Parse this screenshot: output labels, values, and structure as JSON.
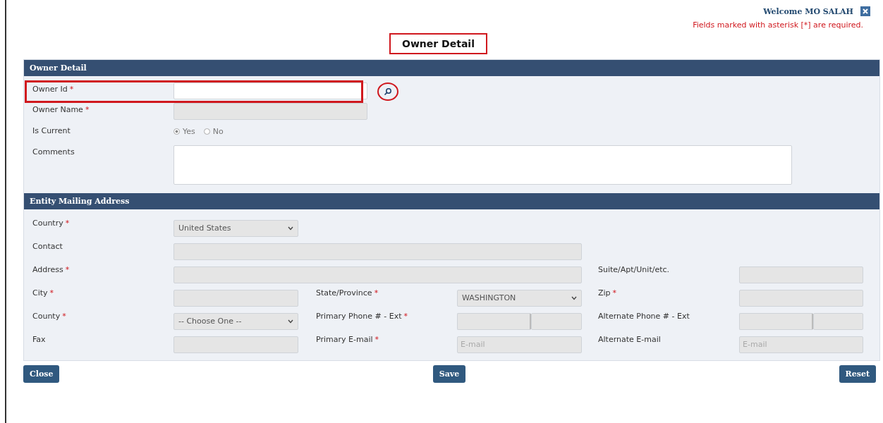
{
  "header": {
    "welcome": "Welcome MO SALAH",
    "required_note": "Fields marked with asterisk [*] are required."
  },
  "title": "Owner Detail",
  "owner_section": {
    "title": "Owner Detail",
    "fields": [
      {
        "label": "Owner Id",
        "required_mark": "*",
        "kind": "lookup",
        "disabled": false,
        "highlighted": true
      },
      {
        "label": "Owner Name",
        "required_mark": "*",
        "kind": "text",
        "disabled": true,
        "highlighted": false
      },
      {
        "label": "Is Current",
        "kind": "radio",
        "options": [
          {
            "label": "Yes",
            "selected": true
          },
          {
            "label": "No",
            "selected": false
          }
        ]
      },
      {
        "label": "Comments",
        "kind": "textarea",
        "disabled": false,
        "highlighted": false
      }
    ]
  },
  "address_section": {
    "title": "Entity Mailing Address",
    "rows": [
      [
        {
          "label": "Country",
          "required_mark": "*",
          "kind": "select",
          "value": "United States"
        }
      ],
      [
        {
          "label": "Contact",
          "kind": "long-text"
        }
      ],
      [
        {
          "label": "Address",
          "required_mark": "*",
          "kind": "long-text"
        },
        "",
        {
          "label": "Suite/Apt/Unit/etc.",
          "kind": "text"
        }
      ],
      [
        {
          "label": "City",
          "required_mark": "*",
          "kind": "text"
        },
        {
          "label": "State/Province",
          "required_mark": "*",
          "kind": "select",
          "value": "WASHINGTON"
        },
        {
          "label": "Zip",
          "required_mark": "*",
          "kind": "text"
        }
      ],
      [
        {
          "label": "County",
          "required_mark": "*",
          "kind": "select",
          "value": "-- Choose One --"
        },
        {
          "label": "Primary Phone # - Ext",
          "required_mark": "*",
          "kind": "phone"
        },
        {
          "label": "Alternate Phone # - Ext",
          "kind": "phone"
        }
      ],
      [
        {
          "label": "Fax",
          "kind": "text"
        },
        {
          "label": "Primary E-mail",
          "required_mark": "*",
          "kind": "email",
          "placeholder": "E-mail"
        },
        {
          "label": "Alternate E-mail",
          "kind": "email",
          "placeholder": "E-mail"
        }
      ]
    ]
  },
  "buttons": [
    "Close",
    "Save",
    "Reset"
  ]
}
